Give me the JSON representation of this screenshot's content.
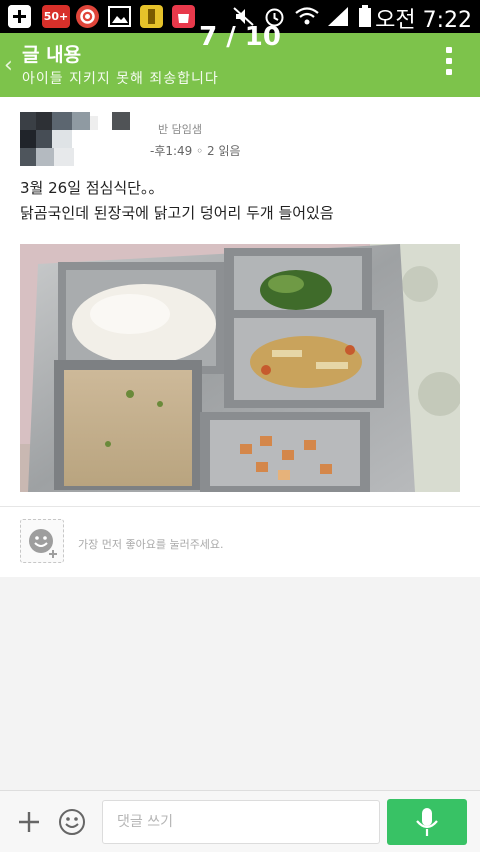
{
  "statusbar": {
    "time": "오전 7:22",
    "photo_counter": "7 / 10",
    "badge_count": "50+"
  },
  "header": {
    "title": "글 내용",
    "subtitle": "아이들 지키지 못해 죄송합니다"
  },
  "post": {
    "author": "반 담임샘",
    "meta": "-후1:49 ◦ 2 읽음",
    "text_line1": "3월 26일 점심식단。。",
    "text_line2": "닭곰국인데 된장국에 닭고기 덩어리 두개 들어있음"
  },
  "like": {
    "prompt": "가장 먼저 좋아요를 눌러주세요."
  },
  "comment": {
    "placeholder": "댓글 쓰기"
  },
  "colors": {
    "header": "#7dc34b",
    "mic_button": "#38c265"
  },
  "icons": [
    "plus-icon",
    "smiley-icon",
    "microphone-icon",
    "more-vertical-icon",
    "back-arrow-icon",
    "like-face-icon"
  ]
}
